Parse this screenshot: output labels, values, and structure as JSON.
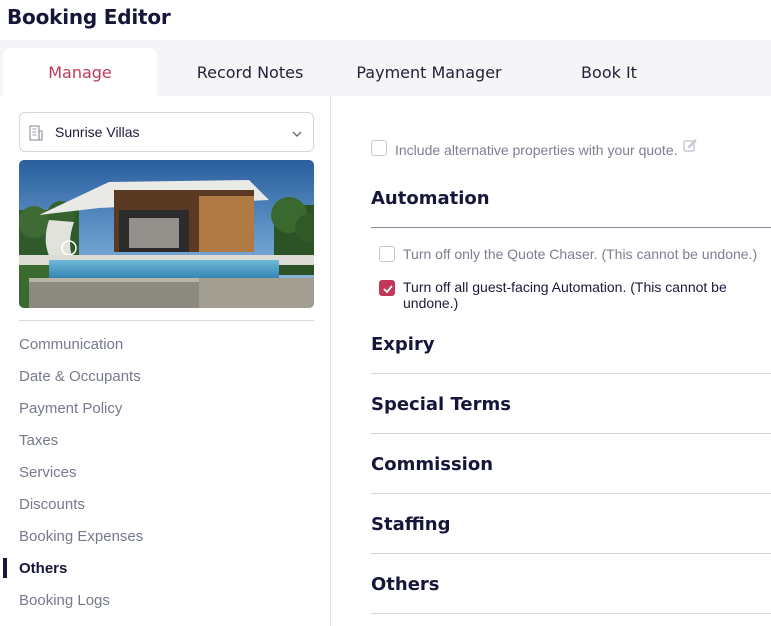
{
  "app": {
    "title": "Booking Editor"
  },
  "tabs": [
    {
      "label": "Manage",
      "active": true
    },
    {
      "label": "Record Notes",
      "active": false
    },
    {
      "label": "Payment Manager",
      "active": false
    },
    {
      "label": "Book It",
      "active": false
    }
  ],
  "sidebar": {
    "property": {
      "name": "Sunrise Villas",
      "icon": "building-icon"
    },
    "image": {
      "alt": "Modern villa with pool"
    },
    "items": [
      {
        "label": "Communication",
        "active": false
      },
      {
        "label": "Date & Occupants",
        "active": false
      },
      {
        "label": "Payment Policy",
        "active": false
      },
      {
        "label": "Taxes",
        "active": false
      },
      {
        "label": "Services",
        "active": false
      },
      {
        "label": "Discounts",
        "active": false
      },
      {
        "label": "Booking Expenses",
        "active": false
      },
      {
        "label": "Others",
        "active": true
      },
      {
        "label": "Booking Logs",
        "active": false
      }
    ]
  },
  "main": {
    "alt_properties": {
      "label": "Include alternative properties with your quote.",
      "checked": false
    },
    "automation": {
      "title": "Automation",
      "options": [
        {
          "label": "Turn off only the Quote Chaser. (This cannot be undone.)",
          "checked": false
        },
        {
          "label": "Turn off all guest-facing Automation. (This cannot be undone.)",
          "checked": true
        }
      ]
    },
    "sections": [
      "Expiry",
      "Special Terms",
      "Commission",
      "Staffing",
      "Others"
    ]
  },
  "colors": {
    "accent": "#c0395a",
    "navy": "#16163a",
    "muted": "#757a8c"
  }
}
